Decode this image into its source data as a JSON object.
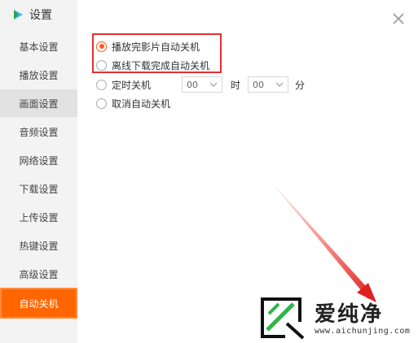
{
  "window": {
    "title": "设置"
  },
  "sidebar": {
    "items": [
      {
        "label": "基本设置"
      },
      {
        "label": "播放设置"
      },
      {
        "label": "画面设置"
      },
      {
        "label": "音频设置"
      },
      {
        "label": "网络设置"
      },
      {
        "label": "下载设置"
      },
      {
        "label": "上传设置"
      },
      {
        "label": "热键设置"
      },
      {
        "label": "高级设置"
      },
      {
        "label": "自动关机"
      }
    ],
    "active": "自动关机"
  },
  "options": {
    "after_play": "播放完影片自动关机",
    "after_download": "离线下载完成自动关机",
    "scheduled": "定时关机",
    "cancel": "取消自动关机",
    "selected": "播放完影片自动关机"
  },
  "schedule": {
    "hour_value": "00",
    "hour_unit": "时",
    "minute_value": "00",
    "minute_unit": "分"
  },
  "watermark": {
    "text": "爱纯净",
    "url": "www.aichunjing.com"
  },
  "colors": {
    "accent": "#ff6600",
    "radio_checked": "#ff5a1f",
    "annotation": "#e53030"
  }
}
